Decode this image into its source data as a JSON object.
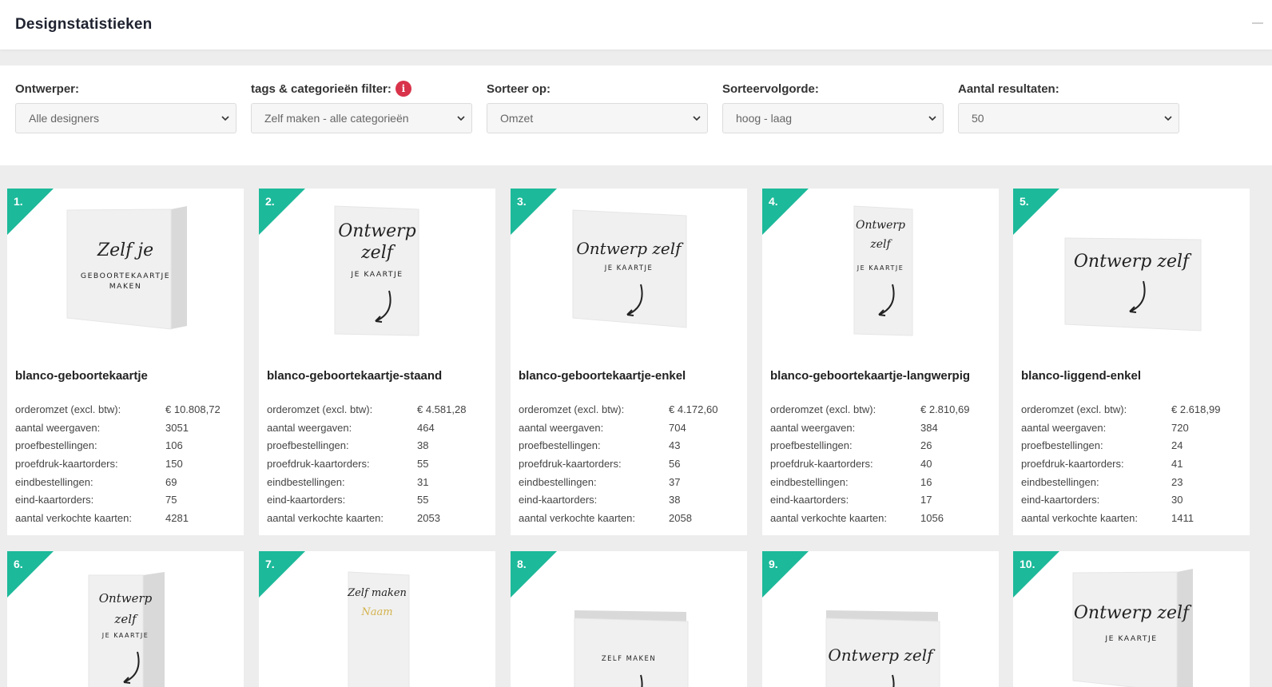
{
  "header": {
    "title": "Designstatistieken"
  },
  "filters": [
    {
      "label": "Ontwerper:",
      "value": "Alle designers",
      "info": false
    },
    {
      "label": "tags & categorieën filter:",
      "value": "Zelf maken - alle categorieën",
      "info": true
    },
    {
      "label": "Sorteer op:",
      "value": "Omzet",
      "info": false
    },
    {
      "label": "Sorteervolgorde:",
      "value": "hoog - laag",
      "info": false
    },
    {
      "label": "Aantal resultaten:",
      "value": "50",
      "info": false
    }
  ],
  "info_glyph": "i",
  "stat_labels": [
    "orderomzet (excl. btw):",
    "aantal weergaven:",
    "proefbestellingen:",
    "proefdruk-kaartorders:",
    "eindbestellingen:",
    "eind-kaartorders:",
    "aantal verkochte kaarten:"
  ],
  "cards": [
    {
      "rank": "1.",
      "name": "blanco-geboortekaartje",
      "thumb": "folded-card",
      "lines": [
        "Zelf je",
        "GEBOORTEKAARTJE",
        "MAKEN"
      ],
      "stats": [
        "€ 10.808,72",
        "3051",
        "106",
        "150",
        "69",
        "75",
        "4281"
      ]
    },
    {
      "rank": "2.",
      "name": "blanco-geboortekaartje-staand",
      "thumb": "portrait-card",
      "lines": [
        "Ontwerp",
        "zelf",
        "JE KAARTJE"
      ],
      "stats": [
        "€ 4.581,28",
        "464",
        "38",
        "55",
        "31",
        "55",
        "2053"
      ]
    },
    {
      "rank": "3.",
      "name": "blanco-geboortekaartje-enkel",
      "thumb": "square-card",
      "lines": [
        "Ontwerp zelf",
        "JE KAARTJE"
      ],
      "stats": [
        "€ 4.172,60",
        "704",
        "43",
        "56",
        "37",
        "38",
        "2058"
      ]
    },
    {
      "rank": "4.",
      "name": "blanco-geboortekaartje-langwerpig",
      "thumb": "tall-card",
      "lines": [
        "Ontwerp",
        "zelf",
        "JE KAARTJE"
      ],
      "stats": [
        "€ 2.810,69",
        "384",
        "26",
        "40",
        "16",
        "17",
        "1056"
      ]
    },
    {
      "rank": "5.",
      "name": "blanco-liggend-enkel",
      "thumb": "landscape-card",
      "lines": [
        "Ontwerp zelf"
      ],
      "stats": [
        "€ 2.618,99",
        "720",
        "24",
        "41",
        "23",
        "30",
        "1411"
      ]
    },
    {
      "rank": "6.",
      "name": "",
      "thumb": "tall-folded-card",
      "lines": [
        "Ontwerp",
        "zelf",
        "JE KAARTJE"
      ],
      "stats": []
    },
    {
      "rank": "7.",
      "name": "",
      "thumb": "gold-card",
      "lines": [
        "Zelf maken",
        "Naam"
      ],
      "stats": []
    },
    {
      "rank": "8.",
      "name": "",
      "thumb": "folded-landscape-card",
      "lines": [
        "ZELF MAKEN"
      ],
      "stats": []
    },
    {
      "rank": "9.",
      "name": "",
      "thumb": "folded-landscape-card",
      "lines": [
        "Ontwerp zelf"
      ],
      "stats": []
    },
    {
      "rank": "10.",
      "name": "",
      "thumb": "folded-card",
      "lines": [
        "Ontwerp zelf",
        "JE KAARTJE"
      ],
      "stats": []
    }
  ],
  "colors": {
    "accent": "#1cb99a",
    "info": "#d8334a"
  }
}
